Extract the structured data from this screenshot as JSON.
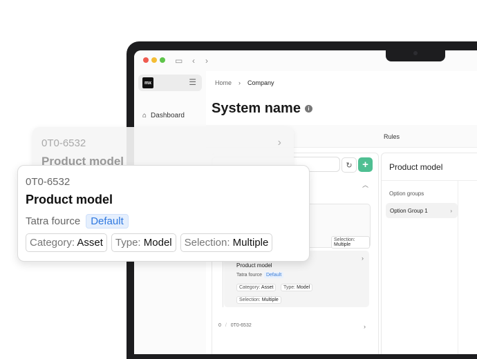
{
  "sidebar": {
    "logo_text": "mx",
    "nav": [
      {
        "label": "Dashboard",
        "icon": "home-icon"
      }
    ]
  },
  "breadcrumb": {
    "home": "Home",
    "sep": "›",
    "current": "Company"
  },
  "page": {
    "title": "System name",
    "info_icon": "i"
  },
  "tabs": {
    "rules": "Rules"
  },
  "toolbar": {
    "refresh_icon": "↻",
    "add_icon": "+"
  },
  "list": {
    "mini_tag_selection_label": "Selection:",
    "mini_tag_selection_value": "Multiple",
    "inner_card": {
      "title": "Product model",
      "brand": "Tatra fource",
      "badge": "Default",
      "category_label": "Category:",
      "category_value": "Asset",
      "type_label": "Type:",
      "type_value": "Model",
      "selection_label": "Selection:",
      "selection_value": "Multiple"
    },
    "bottom_row": {
      "index": "0",
      "sep": "/",
      "id": "0T0-6532"
    }
  },
  "right_panel": {
    "title": "Product model",
    "section_label": "Option groups",
    "item": "Option Group 1"
  },
  "ghost_card": {
    "id": "0T0-6532",
    "title": "Product model"
  },
  "main_card": {
    "id": "0T0-6532",
    "title": "Product model",
    "brand": "Tatra fource",
    "badge": "Default",
    "tags": [
      {
        "label": "Category:",
        "value": "Asset"
      },
      {
        "label": "Type:",
        "value": "Model"
      },
      {
        "label": "Selection:",
        "value": "Multiple"
      }
    ]
  },
  "colors": {
    "accent_green": "#4fbf92",
    "badge_blue": "#2f78e0"
  }
}
